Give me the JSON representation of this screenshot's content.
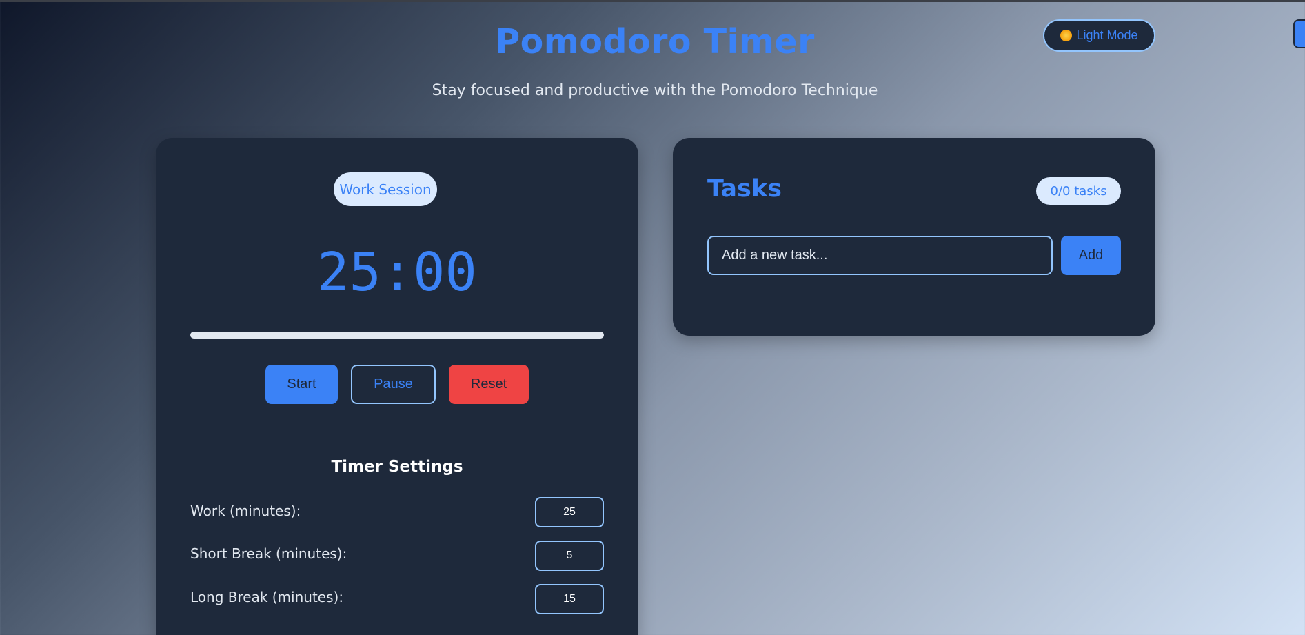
{
  "header": {
    "title": "Pomodoro Timer",
    "subtitle": "Stay focused and productive with the Pomodoro Technique",
    "theme_toggle": {
      "icon": "sun-icon",
      "label": "Light Mode"
    }
  },
  "timer": {
    "session_label": "Work Session",
    "display": "25:00",
    "progress_percent": 0,
    "buttons": {
      "start": "Start",
      "pause": "Pause",
      "reset": "Reset"
    }
  },
  "settings": {
    "title": "Timer Settings",
    "work": {
      "label": "Work (minutes):",
      "value": "25"
    },
    "short_break": {
      "label": "Short Break (minutes):",
      "value": "5"
    },
    "long_break": {
      "label": "Long Break (minutes):",
      "value": "15"
    }
  },
  "tasks": {
    "title": "Tasks",
    "count": "0/0 tasks",
    "input_placeholder": "Add a new task...",
    "add_label": "Add"
  },
  "colors": {
    "accent": "#3b82f6",
    "danger": "#ef4444",
    "card": "#1e293b",
    "pill": "#dbeafe"
  }
}
